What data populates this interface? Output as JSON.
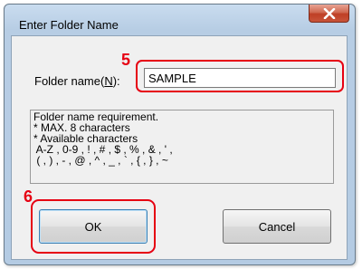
{
  "window": {
    "title": "Enter Folder Name",
    "close_icon": "close-x-icon"
  },
  "annotations": {
    "step_input": "5",
    "step_ok": "6",
    "highlight_color": "#e60012"
  },
  "form": {
    "label_prefix": "Folder name(",
    "label_mnemonic": "N",
    "label_suffix": "):",
    "value": "SAMPLE"
  },
  "requirements": {
    "lines": [
      "Folder name requirement.",
      "* MAX. 8 characters",
      "* Available characters",
      " A-Z , 0-9 , ! , # , $ , % , & , ' ,",
      " ( , ) , - , @ , ^ , _ , ` , { , } , ~"
    ]
  },
  "buttons": {
    "ok_label": "OK",
    "cancel_label": "Cancel"
  }
}
